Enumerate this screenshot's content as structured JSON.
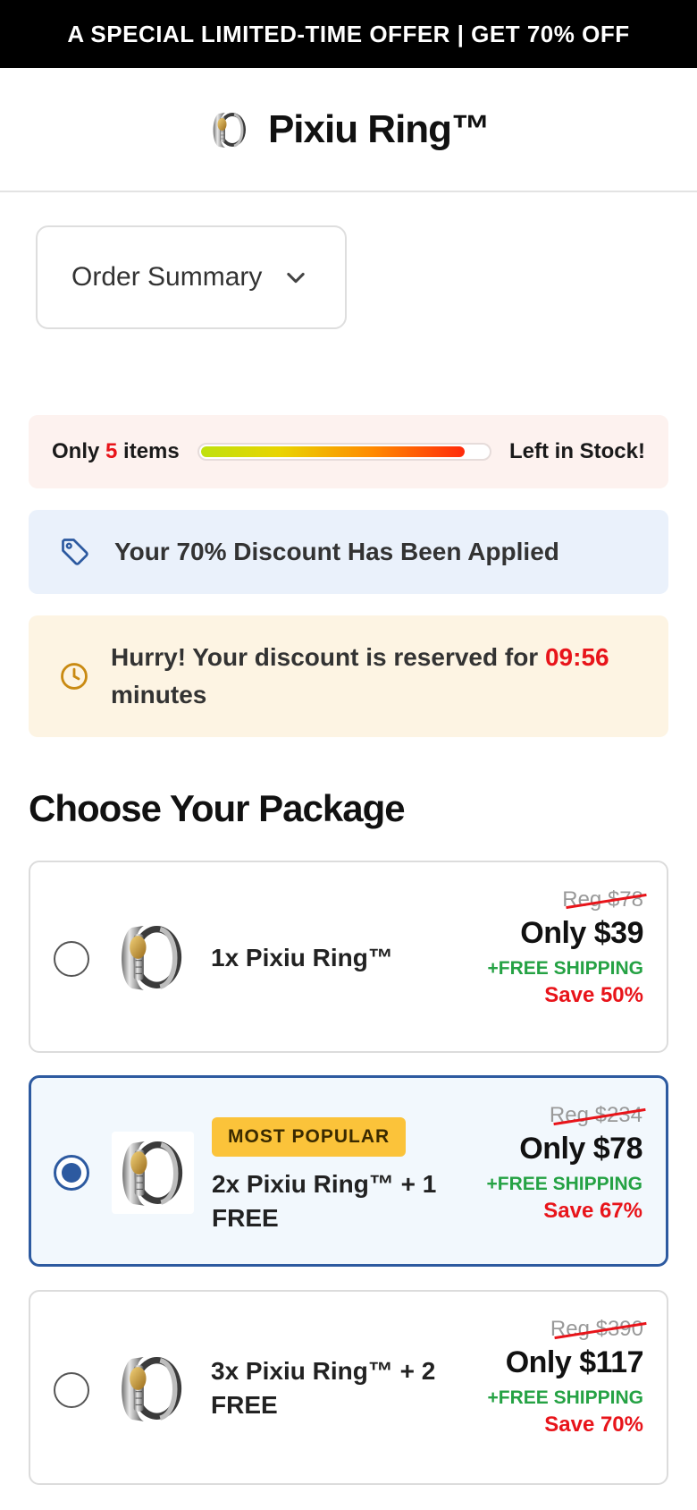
{
  "promo": {
    "text": "A SPECIAL LIMITED-TIME OFFER | GET 70% OFF"
  },
  "header": {
    "brand": "Pixiu Ring™",
    "logo_icon": "ring-logo-icon"
  },
  "order_summary": {
    "label": "Order Summary",
    "icon": "chevron-down-icon"
  },
  "stock": {
    "prefix": "Only",
    "count": "5",
    "suffix": "items",
    "right_text": "Left in Stock!",
    "level": 0.92
  },
  "discount": {
    "text": "Your 70% Discount Has Been Applied",
    "icon": "tag-icon"
  },
  "hurry": {
    "text": "Hurry! Your discount is reserved for",
    "timer": "09:56",
    "suffix": "minutes",
    "icon": "clock-icon"
  },
  "section_title": "Choose Your Package",
  "packages": [
    {
      "name": "1x Pixiu Ring™",
      "badge": "",
      "reg": "Reg $78",
      "price": "Only $39",
      "shipping": "+FREE SHIPPING",
      "save": "Save 50%",
      "selected": false
    },
    {
      "name": "2x Pixiu Ring™ + 1 FREE",
      "badge": "MOST POPULAR",
      "reg": "Reg $234",
      "price": "Only $78",
      "shipping": "+FREE SHIPPING",
      "save": "Save 67%",
      "selected": true
    },
    {
      "name": "3x Pixiu Ring™ + 2 FREE",
      "badge": "",
      "reg": "Reg $390",
      "price": "Only $117",
      "shipping": "+FREE SHIPPING",
      "save": "Save 70%",
      "selected": false
    }
  ],
  "colors": {
    "accent_blue": "#2d5aa0",
    "sale_red": "#e8141a",
    "shipping_green": "#25a244",
    "badge_yellow": "#fbc33a"
  }
}
